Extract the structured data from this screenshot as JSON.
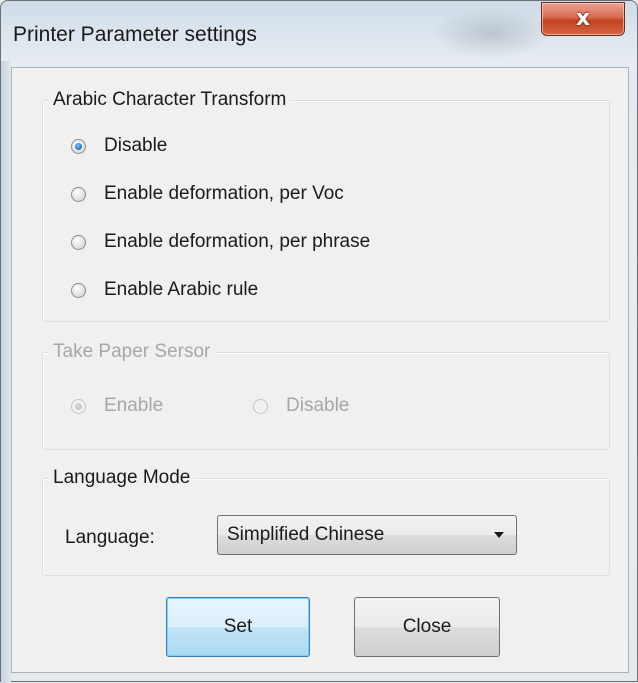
{
  "window": {
    "title": "Printer Parameter settings",
    "close_glyph": "x"
  },
  "arabic_group": {
    "legend": "Arabic Character Transform",
    "options": [
      {
        "label": "Disable",
        "checked": true
      },
      {
        "label": "Enable deformation, per Voc",
        "checked": false
      },
      {
        "label": "Enable deformation, per phrase",
        "checked": false
      },
      {
        "label": "Enable Arabic rule",
        "checked": false
      }
    ]
  },
  "paper_sensor_group": {
    "legend": "Take Paper Sersor",
    "enabled": false,
    "options": [
      {
        "label": "Enable",
        "checked": true
      },
      {
        "label": "Disable",
        "checked": false
      }
    ]
  },
  "language_group": {
    "legend": "Language Mode",
    "label": "Language:",
    "selected": "Simplified Chinese"
  },
  "buttons": {
    "set": "Set",
    "close": "Close"
  },
  "colors": {
    "close_button": "#d05a3c",
    "radio_checked": "#2b79c2",
    "default_button_border": "#3c7fb1",
    "disabled_text": "#a7a7a7"
  }
}
